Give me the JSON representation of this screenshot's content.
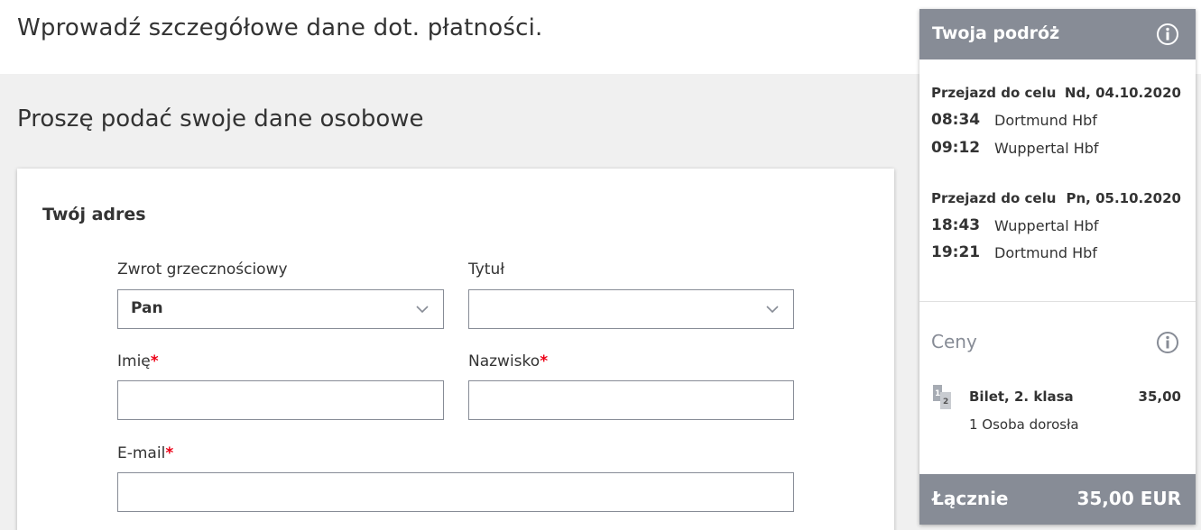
{
  "page": {
    "heading": "Wprowadź szczegółowe dane dot. płatności.",
    "section_heading": "Proszę podać swoje dane osobowe"
  },
  "address_form": {
    "title": "Twój adres",
    "salutation": {
      "label": "Zwrot grzecznościowy",
      "value": "Pan"
    },
    "title_field": {
      "label": "Tytuł",
      "value": ""
    },
    "first_name": {
      "label": "Imię",
      "required_mark": "*",
      "value": ""
    },
    "last_name": {
      "label": "Nazwisko",
      "required_mark": "*",
      "value": ""
    },
    "email": {
      "label": "E-mail",
      "required_mark": "*",
      "value": ""
    }
  },
  "sidebar": {
    "title": "Twoja podróż",
    "trips": [
      {
        "label": "Przejazd do celu",
        "date": "Nd, 04.10.2020",
        "stops": [
          {
            "time": "08:34",
            "station": "Dortmund Hbf"
          },
          {
            "time": "09:12",
            "station": "Wuppertal Hbf"
          }
        ]
      },
      {
        "label": "Przejazd do celu",
        "date": "Pn, 05.10.2020",
        "stops": [
          {
            "time": "18:43",
            "station": "Wuppertal Hbf"
          },
          {
            "time": "19:21",
            "station": "Dortmund Hbf"
          }
        ]
      }
    ],
    "prices_label": "Ceny",
    "ticket": {
      "name": "Bilet, 2. klasa",
      "price": "35,00",
      "passengers": "1 Osoba dorosła"
    },
    "total": {
      "label": "Łącznie",
      "value": "35,00 EUR"
    }
  },
  "colors": {
    "header_grey": "#878c96",
    "required_red": "#ec0016",
    "text": "#333333"
  }
}
